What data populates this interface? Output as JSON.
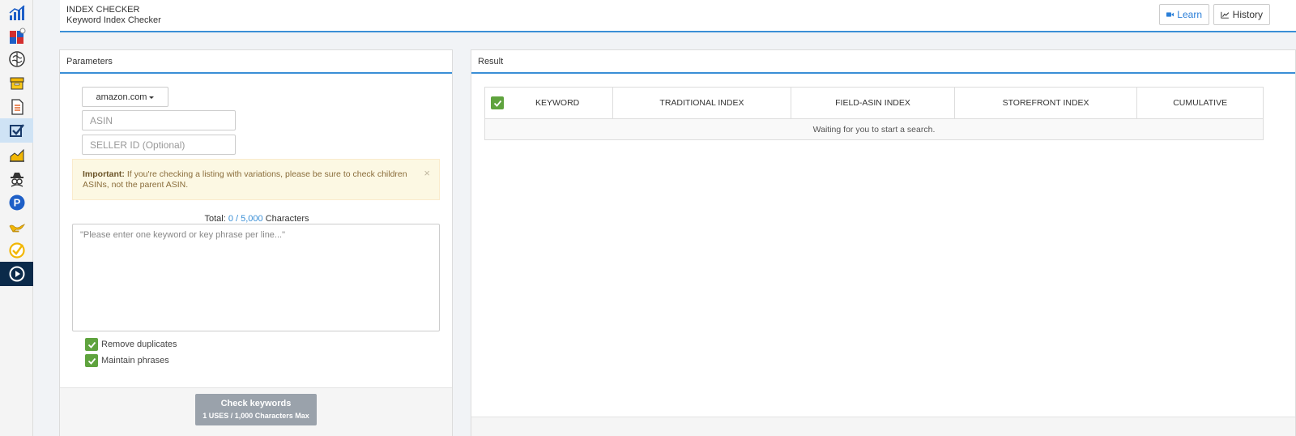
{
  "sidebar": {
    "items": [
      {
        "icon": "bar-chart-icon"
      },
      {
        "icon": "multi-square-icon"
      },
      {
        "icon": "brain-icon"
      },
      {
        "icon": "box-icon"
      },
      {
        "icon": "document-icon"
      },
      {
        "icon": "check-box-icon"
      },
      {
        "icon": "area-chart-icon"
      },
      {
        "icon": "spy-icon"
      },
      {
        "icon": "p-badge-icon"
      },
      {
        "icon": "genie-lamp-icon"
      },
      {
        "icon": "check-circle-icon"
      },
      {
        "icon": "play-icon"
      }
    ]
  },
  "header": {
    "title": "INDEX CHECKER",
    "subtitle": "Keyword Index Checker",
    "learn_label": "Learn",
    "history_label": "History"
  },
  "params": {
    "title": "Parameters",
    "marketplace": "amazon.com",
    "asin_placeholder": "ASIN",
    "seller_placeholder": "SELLER ID (Optional)",
    "alert_bold": "Important:",
    "alert_text": " If you're checking a listing with variations, please be sure to check children ASINs, not the parent ASIN.",
    "alert_close": "×",
    "total_label": "Total:",
    "total_count": "0 / 5,000",
    "total_suffix": "Characters",
    "keywords_placeholder": "\"Please enter one keyword or key phrase per line...\"",
    "remove_duplicates_label": "Remove duplicates",
    "remove_duplicates_checked": true,
    "maintain_phrases_label": "Maintain phrases",
    "maintain_phrases_checked": true,
    "check_button_label": "Check keywords",
    "check_button_sublabel": "1 USES / 1,000 Characters Max"
  },
  "result": {
    "title": "Result",
    "columns": [
      "KEYWORD",
      "TRADITIONAL INDEX",
      "FIELD-ASIN INDEX",
      "STOREFRONT INDEX",
      "CUMULATIVE"
    ],
    "empty_message": "Waiting for you to start a search."
  },
  "colors": {
    "accent": "#3a8fd6",
    "check_green": "#5fa33e",
    "button_disabled": "#9aa2ab",
    "alert_bg": "#fcf8e3"
  }
}
